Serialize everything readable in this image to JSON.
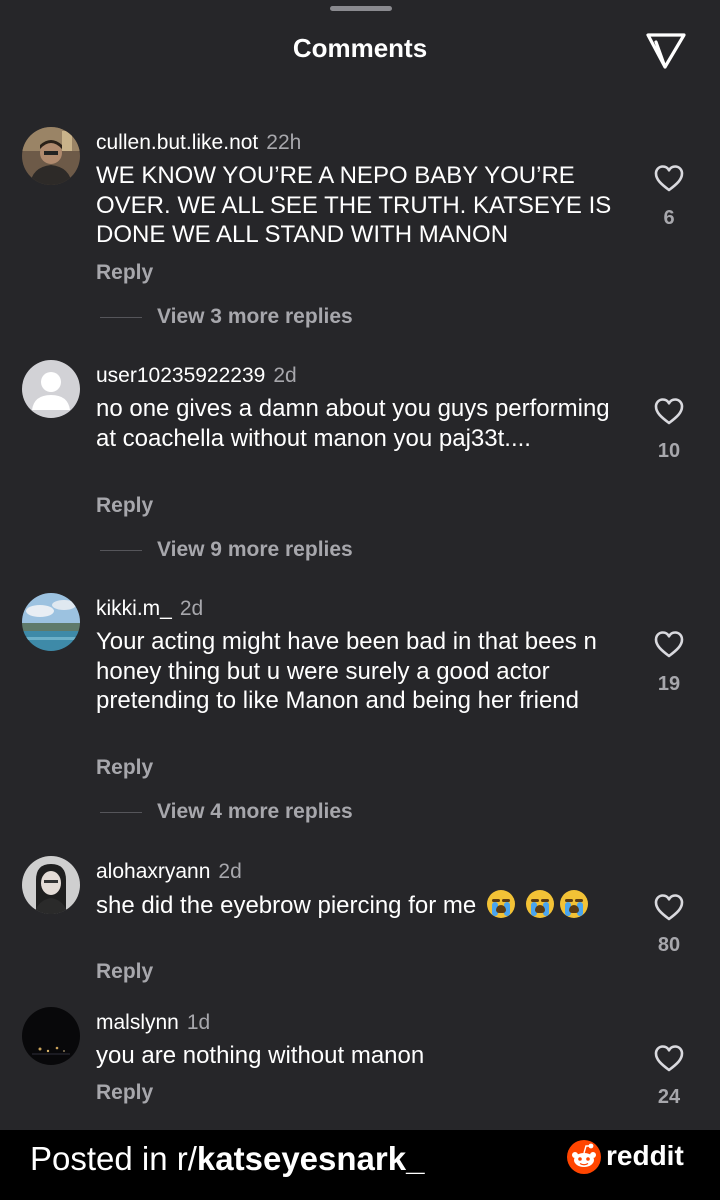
{
  "header": {
    "title": "Comments",
    "share_icon": "paper-plane-icon"
  },
  "comments": [
    {
      "username": "cullen.but.like.not",
      "time": "22h",
      "text": "WE KNOW YOU’RE A NEPO BABY YOU’RE OVER. WE ALL SEE THE TRUTH. KATSEYE IS DONE WE ALL STAND WITH MANON",
      "reply_label": "Reply",
      "view_replies": "View 3 more replies",
      "likes": "6"
    },
    {
      "username": "user10235922239",
      "time": "2d",
      "text": "no one gives a damn about you guys performing at coachella without manon you paj33t....",
      "reply_label": "Reply",
      "view_replies": "View 9 more replies",
      "likes": "10"
    },
    {
      "username": "kikki.m_",
      "time": "2d",
      "text": "Your acting might have been bad in that bees n honey thing but u were surely a good actor pretending to like Manon and being her friend",
      "reply_label": "Reply",
      "view_replies": "View 4 more replies",
      "likes": "19"
    },
    {
      "username": "alohaxryann",
      "time": "2d",
      "text": "she did the eyebrow piercing for me",
      "reply_label": "Reply",
      "likes": "80"
    },
    {
      "username": "malslynn",
      "time": "1d",
      "text": "you are nothing without manon",
      "reply_label": "Reply",
      "likes": "24"
    }
  ],
  "footer": {
    "prefix": "Posted in r/",
    "subreddit": "katseyesnark_",
    "brand": "reddit"
  },
  "colors": {
    "sheet_bg": "#262629",
    "text": "#ffffff",
    "muted": "#a7a7ac",
    "reddit_orange": "#ff4500"
  }
}
